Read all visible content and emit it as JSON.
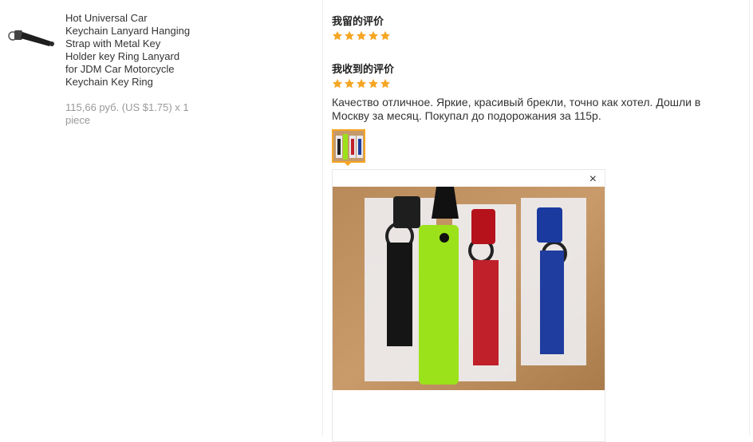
{
  "product": {
    "title": "Hot Universal Car\nKeychain Lanyard Hanging\nStrap with Metal Key\nHolder key Ring Lanyard\nfor JDM Car Motorcycle\nKeychain Key Ring",
    "price": "115,66 руб. (US $1.75) x 1\npiece",
    "thumb_icon": "keychain-strap-image"
  },
  "my_review": {
    "heading": "我留的评价",
    "rating": 5
  },
  "received_review": {
    "heading": "我收到的评价",
    "rating": 5,
    "text": "Качество отличное. Яркие, красивый брекли, точно как хотел. Дошли в Москву за месяц. Покупал до подорожания за 115р.",
    "photo_icon": "keychain-lanyards-photo"
  },
  "viewer": {
    "close_label": "×"
  },
  "colors": {
    "star": "#f5a623",
    "accent_border": "#f5a623",
    "muted_text": "#999999",
    "text": "#333333"
  }
}
